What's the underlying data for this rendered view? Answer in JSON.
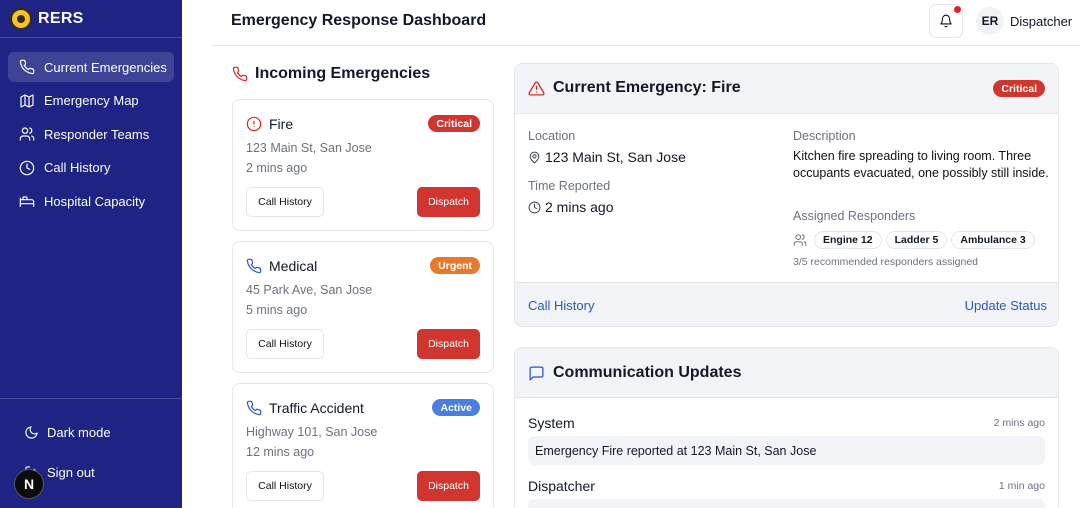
{
  "brand": {
    "name": "RERS"
  },
  "sidebar": {
    "items": [
      {
        "label": "Current Emergencies",
        "icon": "phone-icon",
        "active": true
      },
      {
        "label": "Emergency Map",
        "icon": "map-icon"
      },
      {
        "label": "Responder Teams",
        "icon": "users-icon"
      },
      {
        "label": "Call History",
        "icon": "clock-icon"
      },
      {
        "label": "Hospital Capacity",
        "icon": "bed-icon"
      }
    ],
    "dark_mode": "Dark mode",
    "sign_out": "Sign out",
    "badge": "N"
  },
  "header": {
    "title": "Emergency Response Dashboard",
    "avatar_initials": "ER",
    "user_name": "Dispatcher"
  },
  "incoming": {
    "title": "Incoming Emergencies",
    "cards": [
      {
        "type": "Fire",
        "icon": "alert-circle-icon",
        "badge": "Critical",
        "badge_color": "#d0352f",
        "location": "123 Main St, San Jose",
        "time": "2 mins ago",
        "history_label": "Call History",
        "dispatch_label": "Dispatch"
      },
      {
        "type": "Medical",
        "icon": "phone-icon",
        "badge": "Urgent",
        "badge_color": "#e6792b",
        "location": "45 Park Ave, San Jose",
        "time": "5 mins ago",
        "history_label": "Call History",
        "dispatch_label": "Dispatch"
      },
      {
        "type": "Traffic Accident",
        "icon": "phone-icon",
        "badge": "Active",
        "badge_color": "#4a7fe0",
        "location": "Highway 101, San Jose",
        "time": "12 mins ago",
        "history_label": "Call History",
        "dispatch_label": "Dispatch"
      }
    ]
  },
  "current": {
    "title": "Current Emergency: Fire",
    "badge": "Critical",
    "location_label": "Location",
    "location": "123 Main St, San Jose",
    "time_label": "Time Reported",
    "time": "2 mins ago",
    "description_label": "Description",
    "description": "Kitchen fire spreading to living room. Three occupants evacuated, one possibly still inside.",
    "responders_label": "Assigned Responders",
    "responders": [
      "Engine 12",
      "Ladder 5",
      "Ambulance 3"
    ],
    "responders_note": "3/5 recommended responders assigned",
    "call_history_link": "Call History",
    "update_status_link": "Update Status"
  },
  "comm": {
    "title": "Communication Updates",
    "messages": [
      {
        "sender": "System",
        "time": "2 mins ago",
        "text": "Emergency Fire reported at 123 Main St, San Jose"
      },
      {
        "sender": "Dispatcher",
        "time": "1 min ago",
        "text": ""
      }
    ]
  }
}
